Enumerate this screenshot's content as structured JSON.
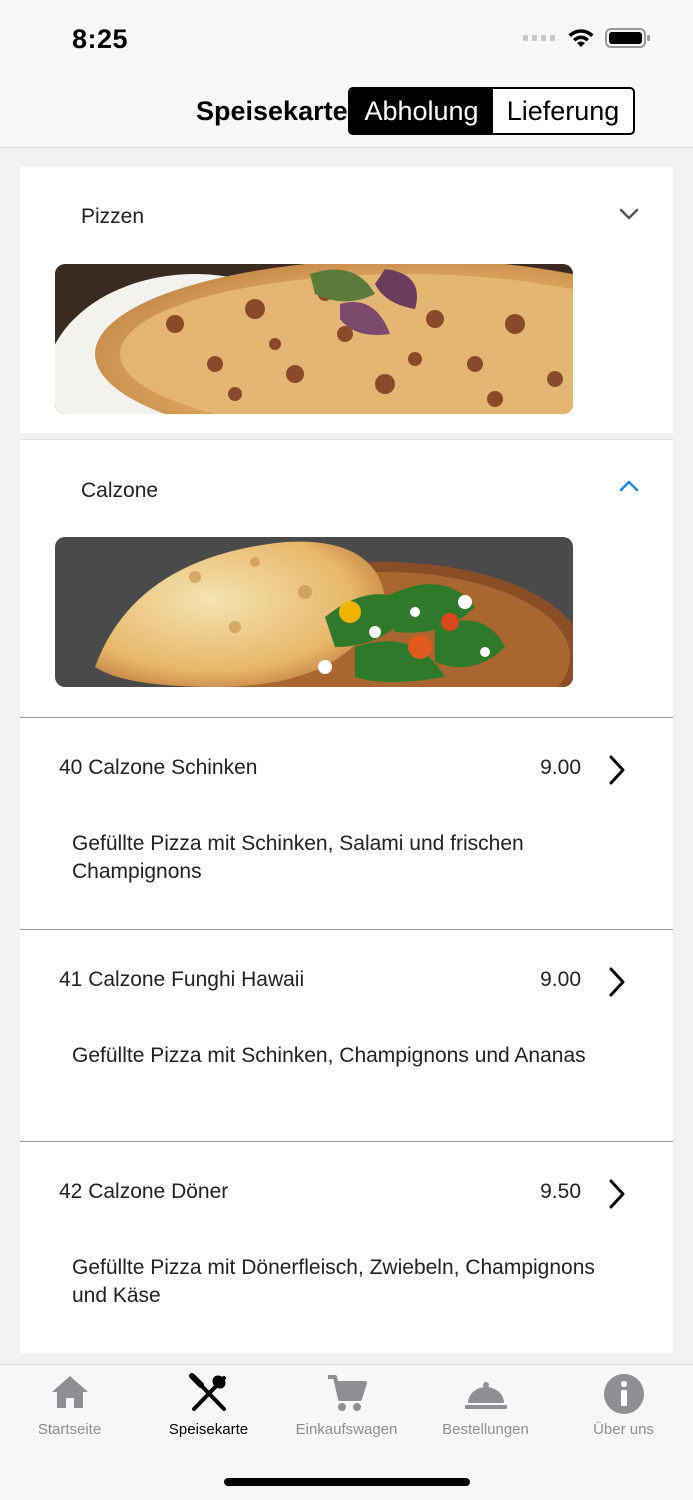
{
  "status_bar": {
    "time": "8:25"
  },
  "header": {
    "title": "Speisekarte",
    "segments": [
      "Abholung",
      "Lieferung"
    ],
    "selected_segment": "Abholung"
  },
  "categories": [
    {
      "name": "Pizzen",
      "expanded": false,
      "chevron": "chevron-down-icon",
      "image": "pizza-photo"
    },
    {
      "name": "Calzone",
      "expanded": true,
      "chevron": "chevron-up-icon",
      "image": "calzone-photo"
    }
  ],
  "items": [
    {
      "name": "40 Calzone Schinken",
      "price": "9.00",
      "description": "Gefüllte Pizza mit Schinken, Salami und frischen Champignons"
    },
    {
      "name": "41 Calzone Funghi Hawaii",
      "price": "9.00",
      "description": "Gefüllte Pizza mit Schinken, Champignons und Ananas"
    },
    {
      "name": "42 Calzone Döner",
      "price": "9.50",
      "description": "Gefüllte Pizza mit Dönerfleisch, Zwiebeln, Champignons und Käse"
    }
  ],
  "tabs": [
    {
      "label": "Startseite",
      "icon": "home-icon",
      "active": false
    },
    {
      "label": "Speisekarte",
      "icon": "cutlery-icon",
      "active": true
    },
    {
      "label": "Einkaufswagen",
      "icon": "cart-icon",
      "active": false
    },
    {
      "label": "Bestellungen",
      "icon": "cloche-icon",
      "active": false
    },
    {
      "label": "Über uns",
      "icon": "info-icon",
      "active": false
    }
  ],
  "colors": {
    "accent": "#1e88e5",
    "inactive_tab": "#8e8e93",
    "active_tab": "#000000"
  }
}
